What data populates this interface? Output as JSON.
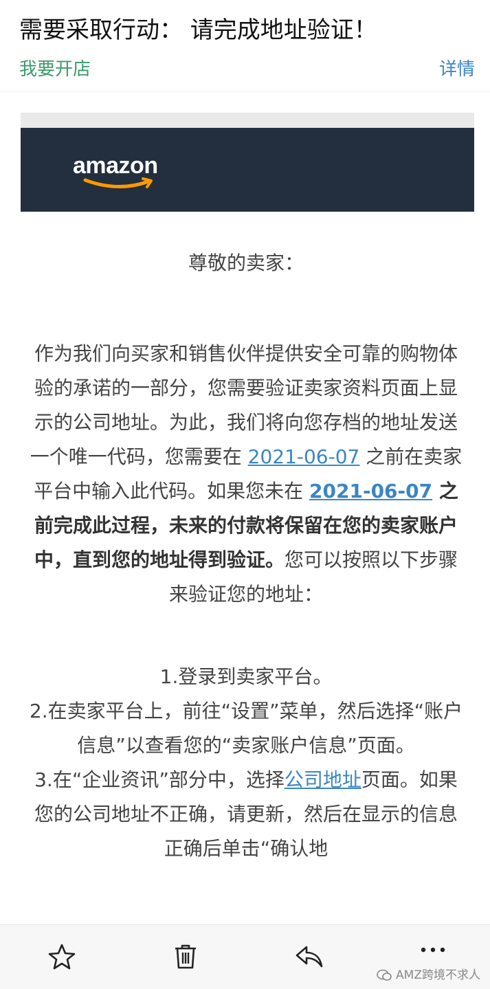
{
  "header": {
    "subject": "需要采取行动： 请完成地址验证！",
    "sender": "我要开店",
    "details_label": "详情"
  },
  "banner": {
    "logo_text": "amazon"
  },
  "body": {
    "greeting": "尊敬的卖家：",
    "p1_part1": "作为我们向买家和销售伙伴提供安全可靠的购物体验的承诺的一部分，您需要验证卖家资料页面上显示的公司地址。为此，我们将向您存档的地址发送一个唯一代码，您需要在 ",
    "date1": "2021-06-07",
    "p1_part2": " 之前在卖家平台中输入此代码。如果您未在 ",
    "date2": "2021-06-07",
    "p1_bold": " 之前完成此过程，未来的付款将保留在您的卖家账户中，直到您的地址得到验证。",
    "p1_end": "您可以按照以下步骤来验证您的地址：",
    "step1": "1.登录到卖家平台。",
    "step2": "2.在卖家平台上，前往“设置”菜单，然后选择“账户信息”以查看您的“卖家账户信息”页面。",
    "step3_part1": "3.在“企业资讯”部分中，选择",
    "step3_link": "公司地址",
    "step3_part2": "页面。如果您的公司地址不正确，请更新，然后在显示的信息正确后单击“确认地"
  },
  "toolbar": {
    "items": [
      "star-icon",
      "trash-icon",
      "reply-icon",
      "more-icon"
    ],
    "watermark": "AMZ跨境不求人"
  },
  "colors": {
    "banner_bg": "#232f3e",
    "link": "#3a86c4",
    "sender": "#3a9b6c",
    "amazon_smile": "#ff9900"
  }
}
